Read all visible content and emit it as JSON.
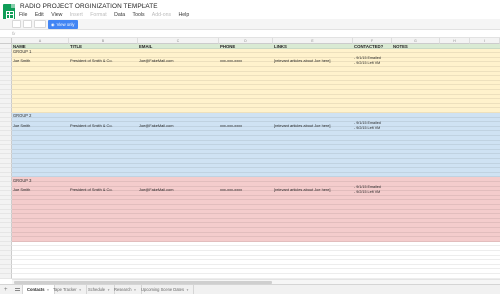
{
  "document": {
    "title": "RADIO PROJECT ORGINIZATION TEMPLATE"
  },
  "menu": [
    "File",
    "Edit",
    "View",
    "Insert",
    "Format",
    "Data",
    "Tools",
    "Add-ons",
    "Help"
  ],
  "menu_disabled": [
    "Insert",
    "Format",
    "Add-ons"
  ],
  "toolbar": {
    "view_only_label": "View only"
  },
  "formula_bar": {
    "fx_label": "fx"
  },
  "columns": [
    "A",
    "B",
    "C",
    "D",
    "E",
    "F",
    "G",
    "H",
    "I"
  ],
  "headers": {
    "name": "NAME",
    "title": "TITLE",
    "email": "EMAIL",
    "phone": "PHONE",
    "links": "LINKS",
    "contacted": "CONTACTED?",
    "notes": "NOTES"
  },
  "groups": [
    {
      "label": "GROUP 1",
      "color": "#fff2cc",
      "contact": {
        "name": "Joe Smith",
        "title": "President of Smith & Co.",
        "email": "Joe@FakeMail.com",
        "phone": "xxx-xxx-xxxx",
        "links": "[relevant articles about Joe here]",
        "contacted": [
          "- 9/1/15 Emailed",
          "- 9/2/15 Left VM"
        ]
      }
    },
    {
      "label": "GROUP 2",
      "color": "#cfe2f3",
      "contact": {
        "name": "Joe Smith",
        "title": "President of Smith & Co.",
        "email": "Joe@FakeMail.com",
        "phone": "xxx-xxx-xxxx",
        "links": "[relevant articles about Joe here]",
        "contacted": [
          "- 9/1/15 Emailed",
          "- 9/2/15 Left VM"
        ]
      }
    },
    {
      "label": "GROUP 3",
      "color": "#f4cccc",
      "contact": {
        "name": "Joe Smith",
        "title": "President of Smith & Co.",
        "email": "Joe@FakeMail.com",
        "phone": "xxx-xxx-xxxx",
        "links": "[relevant articles about Joe here]",
        "contacted": [
          "- 9/1/15 Emailed",
          "- 9/2/15 Left VM"
        ]
      }
    }
  ],
  "header_color": "#d9ead3",
  "sheet_tabs": [
    "Contacts",
    "Tape Tracker",
    "Schedule",
    "Research",
    "Upcoming Scene Dates"
  ],
  "active_tab": "Contacts"
}
